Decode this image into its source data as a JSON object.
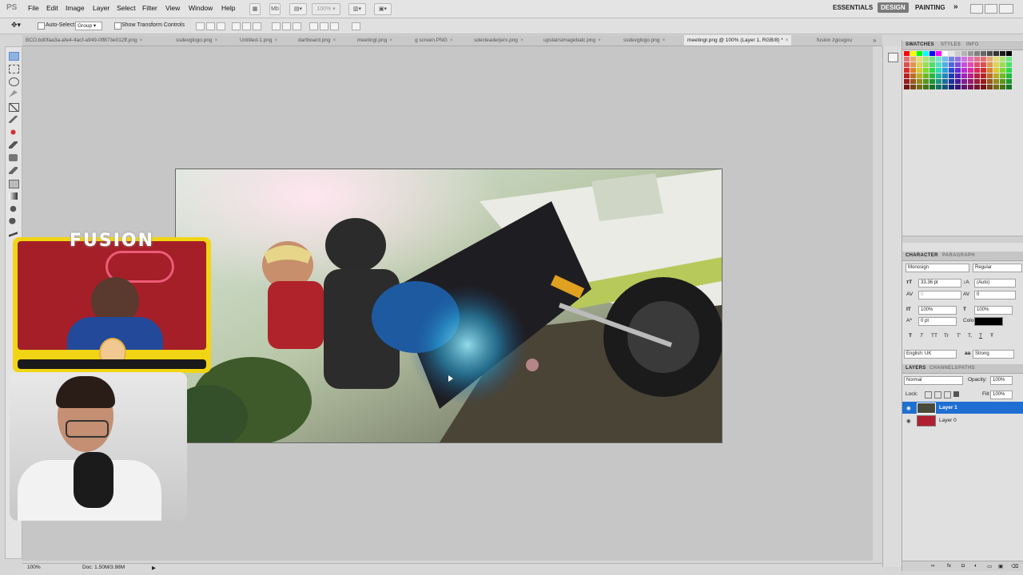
{
  "app": {
    "logo": "PS",
    "menu": [
      "File",
      "Edit",
      "Image",
      "Layer",
      "Select",
      "Filter",
      "View",
      "Window",
      "Help"
    ],
    "app_bar": {
      "mb_label": "Mb",
      "zoom": "100%"
    },
    "workspaces": [
      "ESSENTIALS",
      "DESIGN",
      "PAINTING",
      "»"
    ]
  },
  "options_bar": {
    "auto_select_label": "Auto-Select:",
    "auto_select_value": "Group",
    "show_transform_label": "Show Transform Controls"
  },
  "tabs": [
    {
      "label": "BCO.bd0faa3a-afe4-4acf-a949-0ff873e012ff.png",
      "active": false
    },
    {
      "label": "ssdevglogo.png",
      "active": false
    },
    {
      "label": "Untitled-1.png",
      "active": false
    },
    {
      "label": "dartboard.png",
      "active": false
    },
    {
      "label": "meetingl.png",
      "active": false
    },
    {
      "label": "g screen.PNG",
      "active": false
    },
    {
      "label": "sdecleaderjerx.png",
      "active": false
    },
    {
      "label": "upstairsimagebalc.png",
      "active": false
    },
    {
      "label": "ssdevglogo.png",
      "active": false
    },
    {
      "label": "meetingr.png @ 100% (Layer 1, RGB/8) *",
      "active": true
    },
    {
      "label": "fusion zgougou",
      "active": false
    }
  ],
  "overlay": {
    "brand_text": "FUSION"
  },
  "swatches_panel": {
    "tabs": [
      "SWATCHES",
      "STYLES",
      "INFO"
    ],
    "colors": [
      "#ff0000",
      "#ffff00",
      "#00ff00",
      "#00ffff",
      "#0000ff",
      "#ff00ff",
      "#ffffff",
      "#e6e6e6",
      "#cccccc",
      "#b3b3b3",
      "#999999",
      "#808080",
      "#666666",
      "#4d4d4d",
      "#333333",
      "#1a1a1a",
      "#000000"
    ]
  },
  "character_panel": {
    "tabs": [
      "CHARACTER",
      "PARAGRAPH"
    ],
    "font_family": "Monosign",
    "font_style": "Regular",
    "font_size": "33.36 pt",
    "leading": "(Auto)",
    "kerning": "0",
    "tracking": "0",
    "vscale": "100%",
    "hscale": "100%",
    "baseline": "0 pt",
    "color_label": "Color:",
    "type_buttons": [
      "T",
      "T",
      "TT",
      "Tr",
      "T'",
      "T,",
      "T",
      "Ŧ"
    ],
    "language": "English: UK",
    "antialias_label": "aa",
    "antialias": "Strong"
  },
  "layers_panel": {
    "tabs": [
      "LAYERS",
      "CHANNELS",
      "PATHS"
    ],
    "blend_mode": "Normal",
    "opacity_label": "Opacity:",
    "opacity": "100%",
    "lock_label": "Lock:",
    "fill_label": "Fill:",
    "fill": "100%",
    "layers": [
      {
        "name": "Layer 1",
        "selected": true
      },
      {
        "name": "Layer 0",
        "selected": false
      }
    ]
  },
  "status_bar": {
    "zoom": "100%",
    "doc_info": "Doc: 1.50M/3.98M"
  },
  "colors": {
    "accent": "#1f6fd2",
    "overlay_frame": "#f1d515"
  }
}
